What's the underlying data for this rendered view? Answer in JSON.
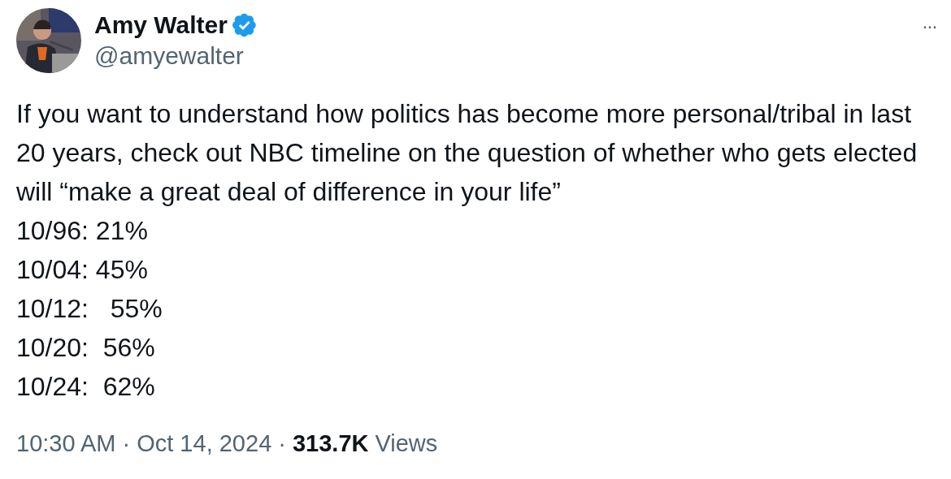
{
  "author": {
    "name": "Amy Walter",
    "verified": true,
    "handle": "@amyewalter"
  },
  "more_menu": "···",
  "text": "If you want to understand how politics has become more personal/tribal in last 20 years, check out NBC timeline on the question of whether who gets elected will “make a great deal of difference in your life”",
  "lines": [
    "10/96: 21%",
    "10/04: 45%",
    "10/12:   55%",
    "10/20:  56%",
    "10/24:  62%"
  ],
  "meta": {
    "time": "10:30 AM",
    "separator": "·",
    "date": "Oct 14, 2024",
    "views_count": "313.7K",
    "views_label": "Views"
  }
}
